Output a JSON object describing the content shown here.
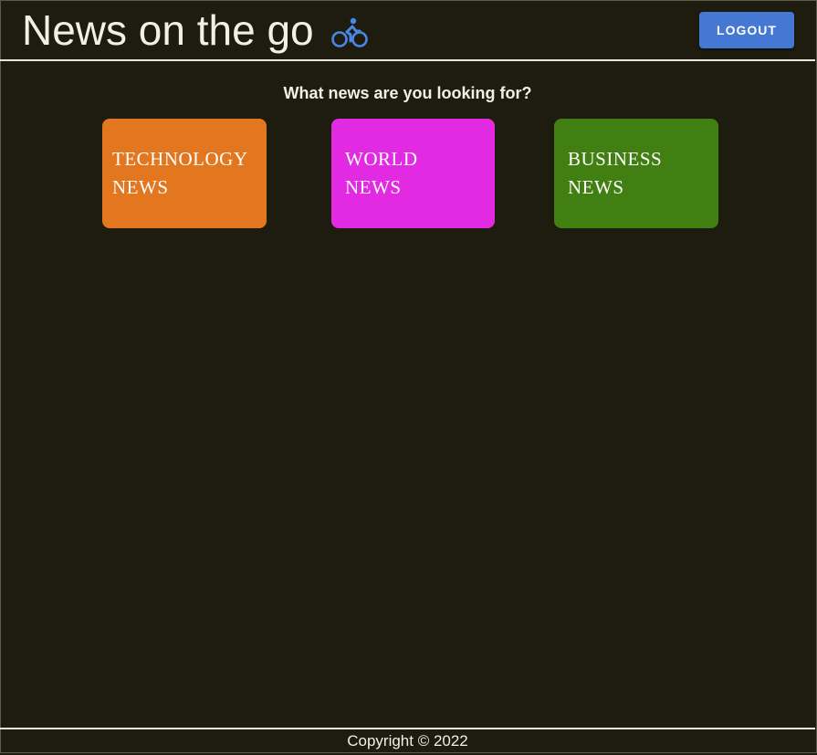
{
  "header": {
    "title": "News on the go",
    "icon": "bicycle-icon",
    "icon_color": "#4a86e8",
    "logout_label": "LOGOUT",
    "logout_color": "#4478d2"
  },
  "main": {
    "prompt": "What news are you looking for?",
    "categories": [
      {
        "label_line1": "TECHNOLOGY",
        "label_line2": "NEWS",
        "color": "#e2771f"
      },
      {
        "label_line1": "WORLD",
        "label_line2": "NEWS",
        "color": "#e22ae2"
      },
      {
        "label_line1": "BUSINESS",
        "label_line2": "NEWS",
        "color": "#417f12"
      }
    ]
  },
  "footer": {
    "copyright": "Copyright © 2022"
  },
  "theme": {
    "background": "#1e1c0f",
    "text": "#f2f0e6"
  }
}
